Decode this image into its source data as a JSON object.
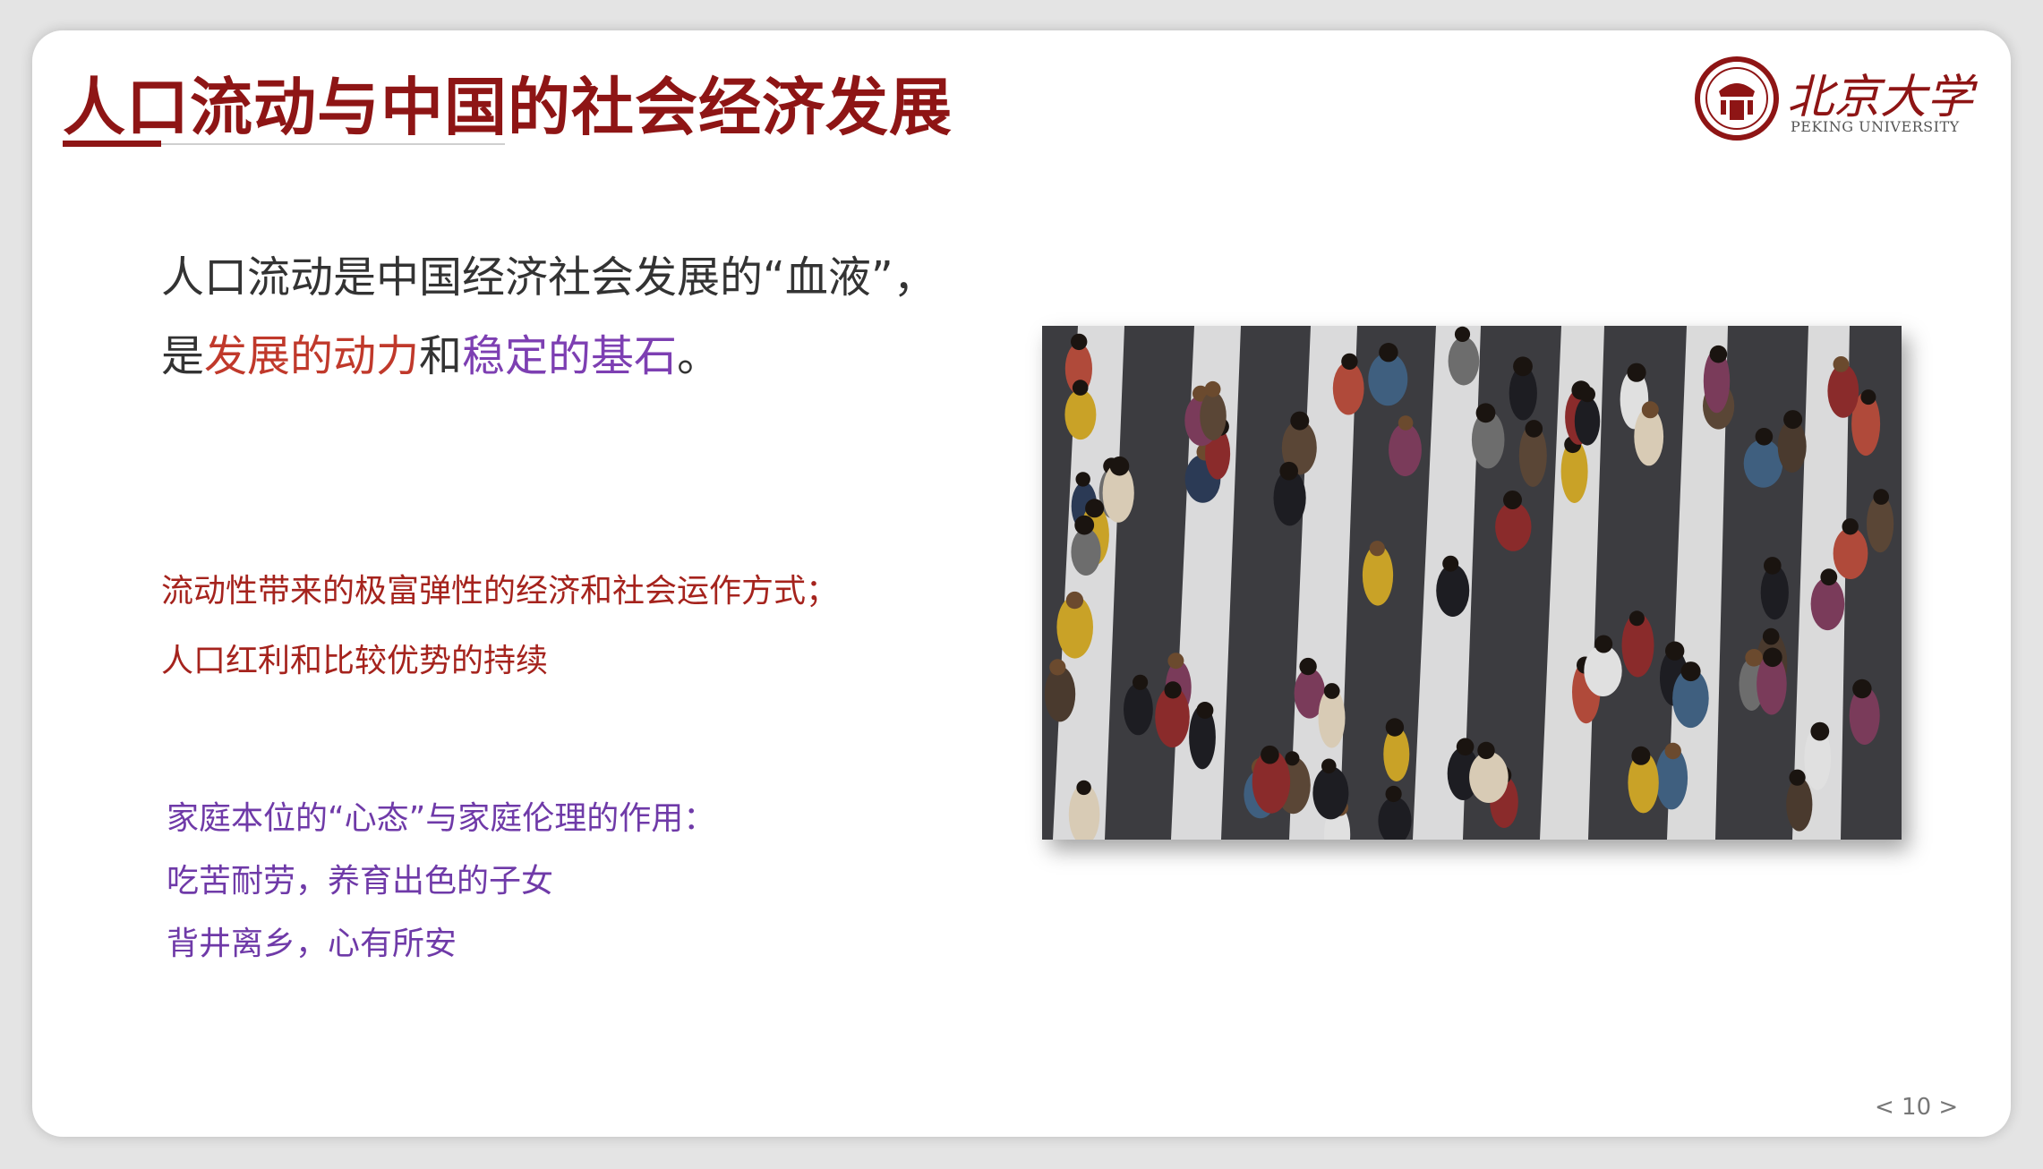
{
  "slide": {
    "title": "人口流动与中国的社会经济发展",
    "logo": {
      "name_cn": "北京大学",
      "name_en": "PEKING UNIVERSITY"
    },
    "lead": {
      "line1": "人口流动是中国经济社会发展的“血液”，",
      "line2_a": "是",
      "line2_b": "发展的动力",
      "line2_c": "和",
      "line2_d": "稳定的基石",
      "line2_e": "。"
    },
    "red_points": [
      "流动性带来的极富弹性的经济和社会运作方式；",
      "人口红利和比较优势的持续"
    ],
    "purple_points": [
      "家庭本位的“心态”与家庭伦理的作用：",
      "吃苦耐劳，养育出色的子女",
      "背井离乡，心有所安"
    ],
    "page_number": "< 10 >",
    "colors": {
      "title": "#8e1515",
      "highlight_red": "#c0392b",
      "highlight_purple": "#7d3fb2"
    }
  }
}
